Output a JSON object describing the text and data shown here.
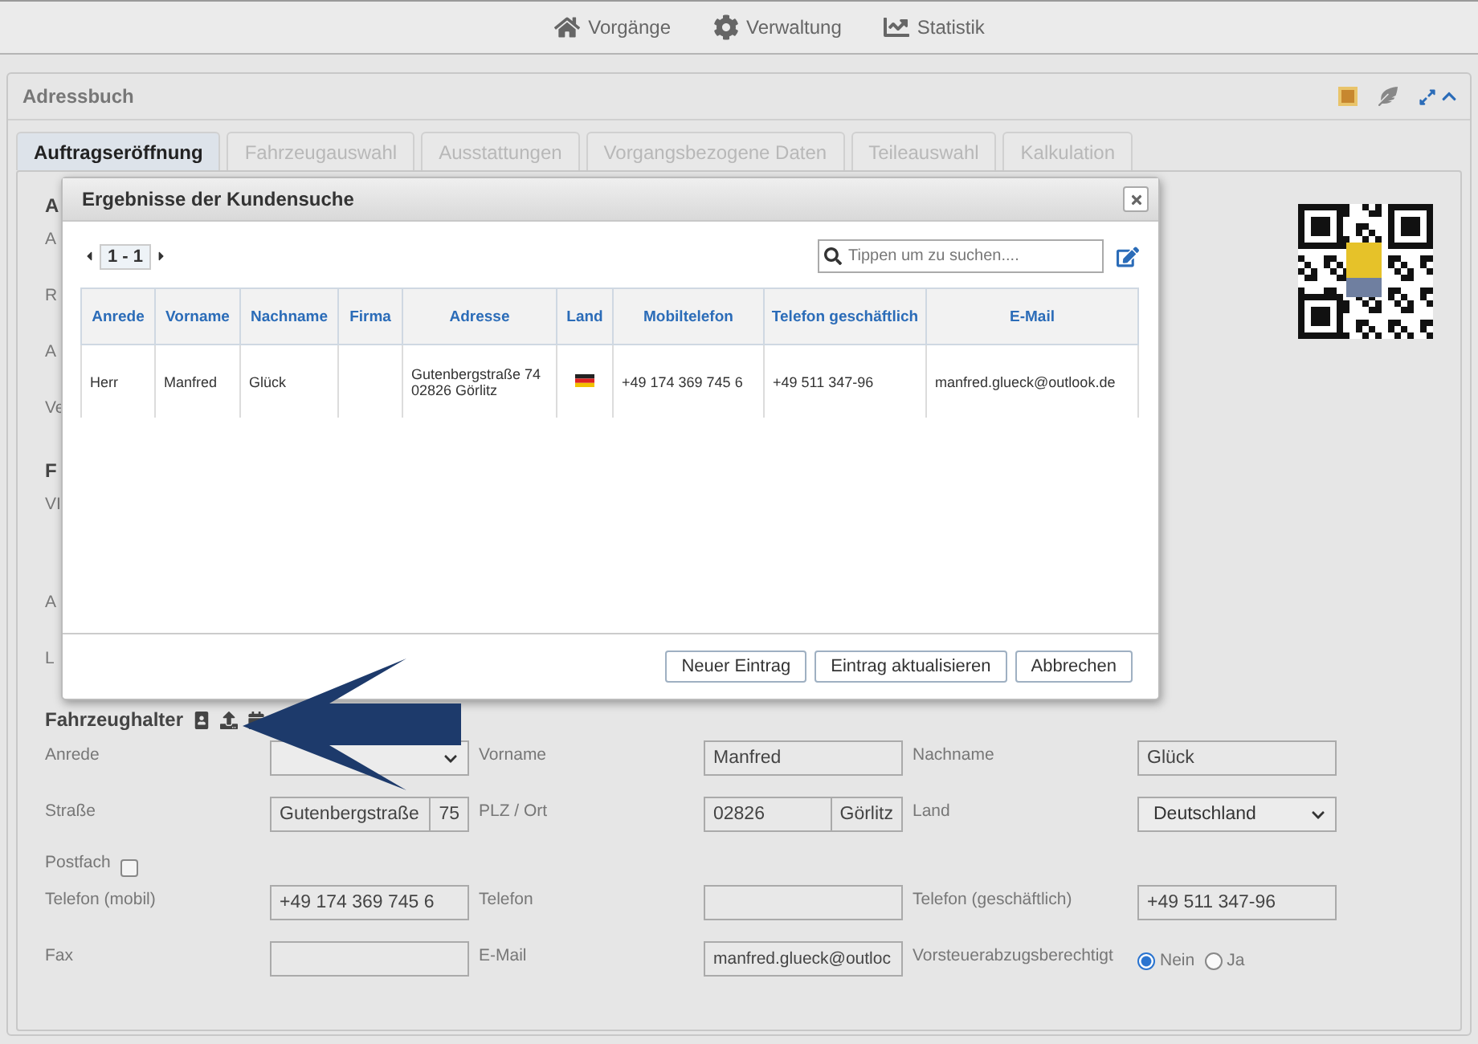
{
  "nav": [
    {
      "label": "Vorgänge"
    },
    {
      "label": "Verwaltung"
    },
    {
      "label": "Statistik"
    }
  ],
  "panel": {
    "title": "Adressbuch"
  },
  "tabs": [
    {
      "label": "Auftragseröffnung",
      "selected": true
    },
    {
      "label": "Fahrzeugauswahl",
      "selected": false
    },
    {
      "label": "Ausstattungen",
      "selected": false
    },
    {
      "label": "Vorgangsbezogene Daten",
      "selected": false
    },
    {
      "label": "Teileauswahl",
      "selected": false
    },
    {
      "label": "Kalkulation",
      "selected": false
    }
  ],
  "background_labels": [
    {
      "text": "A",
      "kind": "heading"
    },
    {
      "text": "A",
      "kind": "label"
    },
    {
      "text": "R",
      "kind": "label"
    },
    {
      "text": "A",
      "kind": "label"
    },
    {
      "text": "Ve",
      "kind": "label"
    },
    {
      "text": "F",
      "kind": "heading"
    },
    {
      "text": "VI",
      "kind": "label"
    },
    {
      "text": "A",
      "kind": "label"
    },
    {
      "text": "L",
      "kind": "label"
    }
  ],
  "dialog": {
    "title": "Ergebnisse der Kundensuche",
    "pager": "1 - 1",
    "search": {
      "placeholder": "Tippen um zu suchen...."
    },
    "columns": [
      "Anrede",
      "Vorname",
      "Nachname",
      "Firma",
      "Adresse",
      "Land",
      "Mobiltelefon",
      "Telefon geschäftlich",
      "E-Mail"
    ],
    "rows": [
      {
        "cells": [
          {
            "kind": "text",
            "text": "Herr"
          },
          {
            "kind": "text",
            "text": "Manfred"
          },
          {
            "kind": "text",
            "text": "Glück"
          },
          {
            "kind": "empty"
          },
          {
            "kind": "lines",
            "lines": [
              "Gutenbergstraße 74",
              "02826 Görlitz"
            ]
          },
          {
            "kind": "flag"
          },
          {
            "kind": "text",
            "text": "+49 174 369 745 6"
          },
          {
            "kind": "text",
            "text": "+49 511 347-96"
          },
          {
            "kind": "text",
            "text": "manfred.glueck@outlook.de"
          }
        ]
      }
    ],
    "buttons": [
      "Neuer Eintrag",
      "Eintrag aktualisieren",
      "Abbrechen"
    ]
  },
  "holder": {
    "title": "Fahrzeughalter",
    "rows": [
      [
        {
          "label": "Anrede",
          "kind": "select"
        },
        {
          "label": "Vorname",
          "kind": "input",
          "value": "Manfred"
        },
        {
          "label": "Nachname",
          "kind": "input",
          "value": "Glück"
        }
      ],
      [
        {
          "label": "Straße",
          "kind": "pair",
          "values": [
            "Gutenbergstraße",
            "75"
          ]
        },
        {
          "label": "PLZ / Ort",
          "kind": "pair",
          "values": [
            "02826",
            "Görlitz"
          ]
        },
        {
          "label": "Land",
          "kind": "select",
          "value": "Deutschland"
        }
      ],
      [
        {
          "label": "Postfach",
          "kind": "checkbox",
          "checked": false
        }
      ],
      [
        {
          "label": "Telefon (mobil)",
          "kind": "input",
          "value": "+49 174 369 745 6"
        },
        {
          "label": "Telefon",
          "kind": "input"
        },
        {
          "label": "Telefon (geschäftlich)",
          "kind": "input",
          "value": "+49 511 347-96"
        }
      ],
      [
        {
          "label": "Fax",
          "kind": "input"
        },
        {
          "label": "E-Mail",
          "kind": "input",
          "value": "manfred.glueck@outloc"
        },
        {
          "label": "Vorsteuerabzugsberechtigt",
          "kind": "radio",
          "options": [
            {
              "label": "Nein",
              "selected": true
            },
            {
              "label": "Ja",
              "selected": false
            }
          ]
        }
      ]
    ]
  }
}
